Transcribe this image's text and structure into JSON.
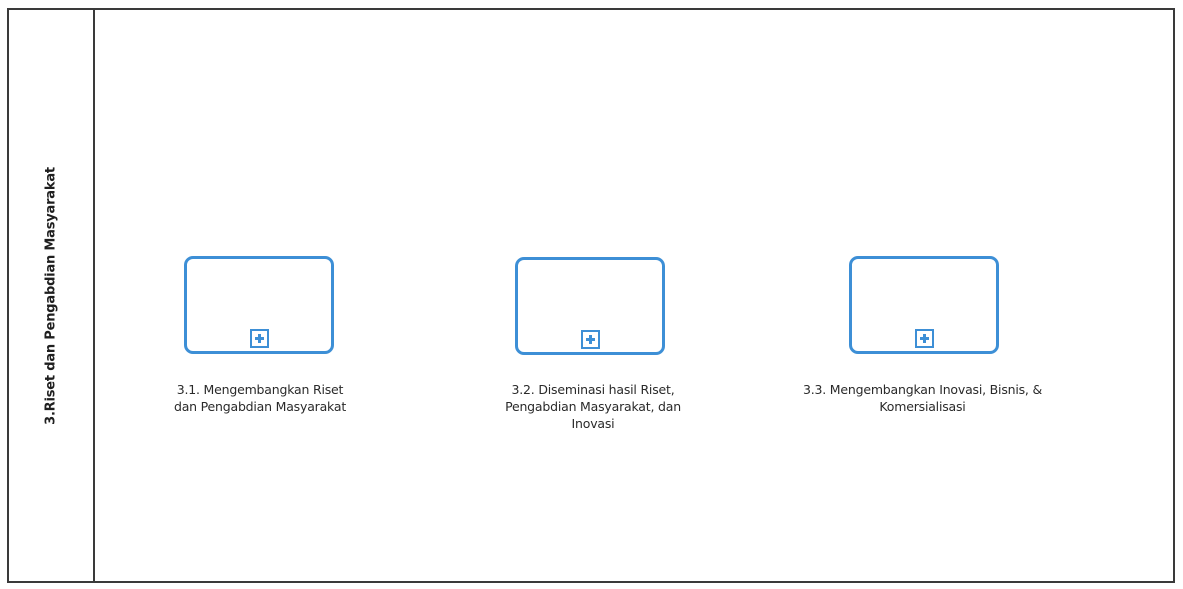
{
  "lane": {
    "title": "3.Riset dan Pengabdian Masyarakat"
  },
  "subprocesses": [
    {
      "label_lines": [
        "3.1. Mengembangkan Riset",
        "dan Pengabdian Masyarakat"
      ],
      "marker_icon": "plus-icon"
    },
    {
      "label_lines": [
        "3.2. Diseminasi hasil Riset,",
        "Pengabdian Masyarakat, dan",
        "Inovasi"
      ],
      "marker_icon": "plus-icon"
    },
    {
      "label_lines": [
        "3.3. Mengembangkan Inovasi, Bisnis, &",
        "Komersialisasi"
      ],
      "marker_icon": "plus-icon"
    }
  ],
  "colors": {
    "task_border": "#3d8fd6",
    "lane_border": "#3a3a3a"
  }
}
